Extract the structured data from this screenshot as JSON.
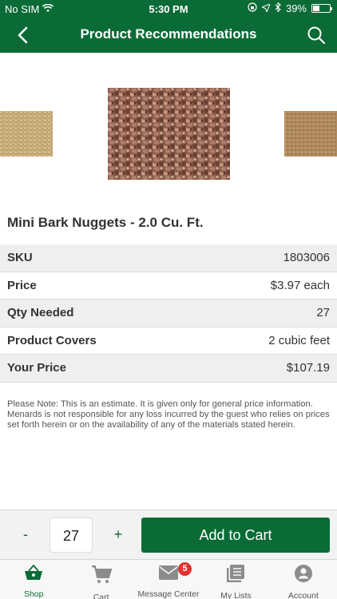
{
  "status_bar": {
    "carrier": "No SIM",
    "time": "5:30 PM",
    "battery_percent": "39%",
    "battery_level": 0.39
  },
  "nav": {
    "title": "Product Recommendations",
    "back_icon": "chevron-left-icon",
    "search_icon": "search-icon"
  },
  "product": {
    "name": "Mini Bark Nuggets - 2.0 Cu. Ft."
  },
  "specs": [
    {
      "label": "SKU",
      "value": "1803006"
    },
    {
      "label": "Price",
      "value": "$3.97 each"
    },
    {
      "label": "Qty Needed",
      "value": "27"
    },
    {
      "label": "Product Covers",
      "value": "2 cubic feet"
    },
    {
      "label": "Your Price",
      "value": "$107.19"
    }
  ],
  "note": "Please Note: This is an estimate. It is given only for general price information. Menards is not responsible for any loss incurred by the guest who relies on prices set forth herein or on the availability of any of the materials stated herein.",
  "cart": {
    "minus_label": "-",
    "quantity": "27",
    "plus_label": "+",
    "add_label": "Add to Cart"
  },
  "tabs": [
    {
      "label": "Shop",
      "icon": "shopping-basket-icon",
      "active": true
    },
    {
      "label": "Cart",
      "icon": "cart-icon"
    },
    {
      "label": "Message Center",
      "icon": "envelope-icon",
      "badge": "5"
    },
    {
      "label": "My Lists",
      "icon": "list-icon"
    },
    {
      "label": "Account",
      "icon": "user-icon"
    }
  ],
  "colors": {
    "brand_green": "#0b6b36",
    "badge_red": "#e0322e"
  }
}
